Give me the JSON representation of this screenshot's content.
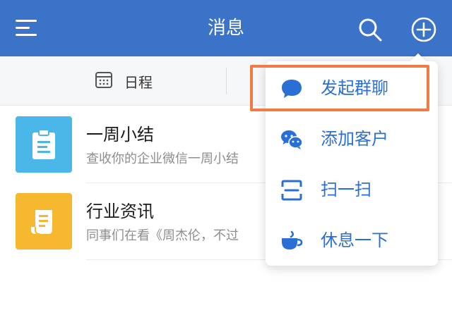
{
  "header": {
    "title": "消息",
    "menu_icon": "menu-icon",
    "search_icon": "search-icon",
    "add_icon": "plus-circle-icon",
    "bg_color": "#3b73c8"
  },
  "tabs": [
    {
      "label": "日程",
      "icon": "calendar-icon"
    }
  ],
  "list": [
    {
      "title": "一周小结",
      "subtitle": "查收你的企业微信一周小结",
      "icon": "clipboard-icon",
      "color": "#4bb6e8"
    },
    {
      "title": "行业资讯",
      "subtitle": "同事们在看《周杰伦，不过",
      "icon": "scroll-icon",
      "color": "#f5b82e"
    }
  ],
  "dropdown": {
    "items": [
      {
        "label": "发起群聊",
        "icon": "chat-bubble-icon"
      },
      {
        "label": "添加客户",
        "icon": "wechat-icon"
      },
      {
        "label": "扫一扫",
        "icon": "scan-icon"
      },
      {
        "label": "休息一下",
        "icon": "coffee-cup-icon"
      }
    ],
    "text_color": "#2a6fd6",
    "highlight_color": "#f07c45"
  }
}
